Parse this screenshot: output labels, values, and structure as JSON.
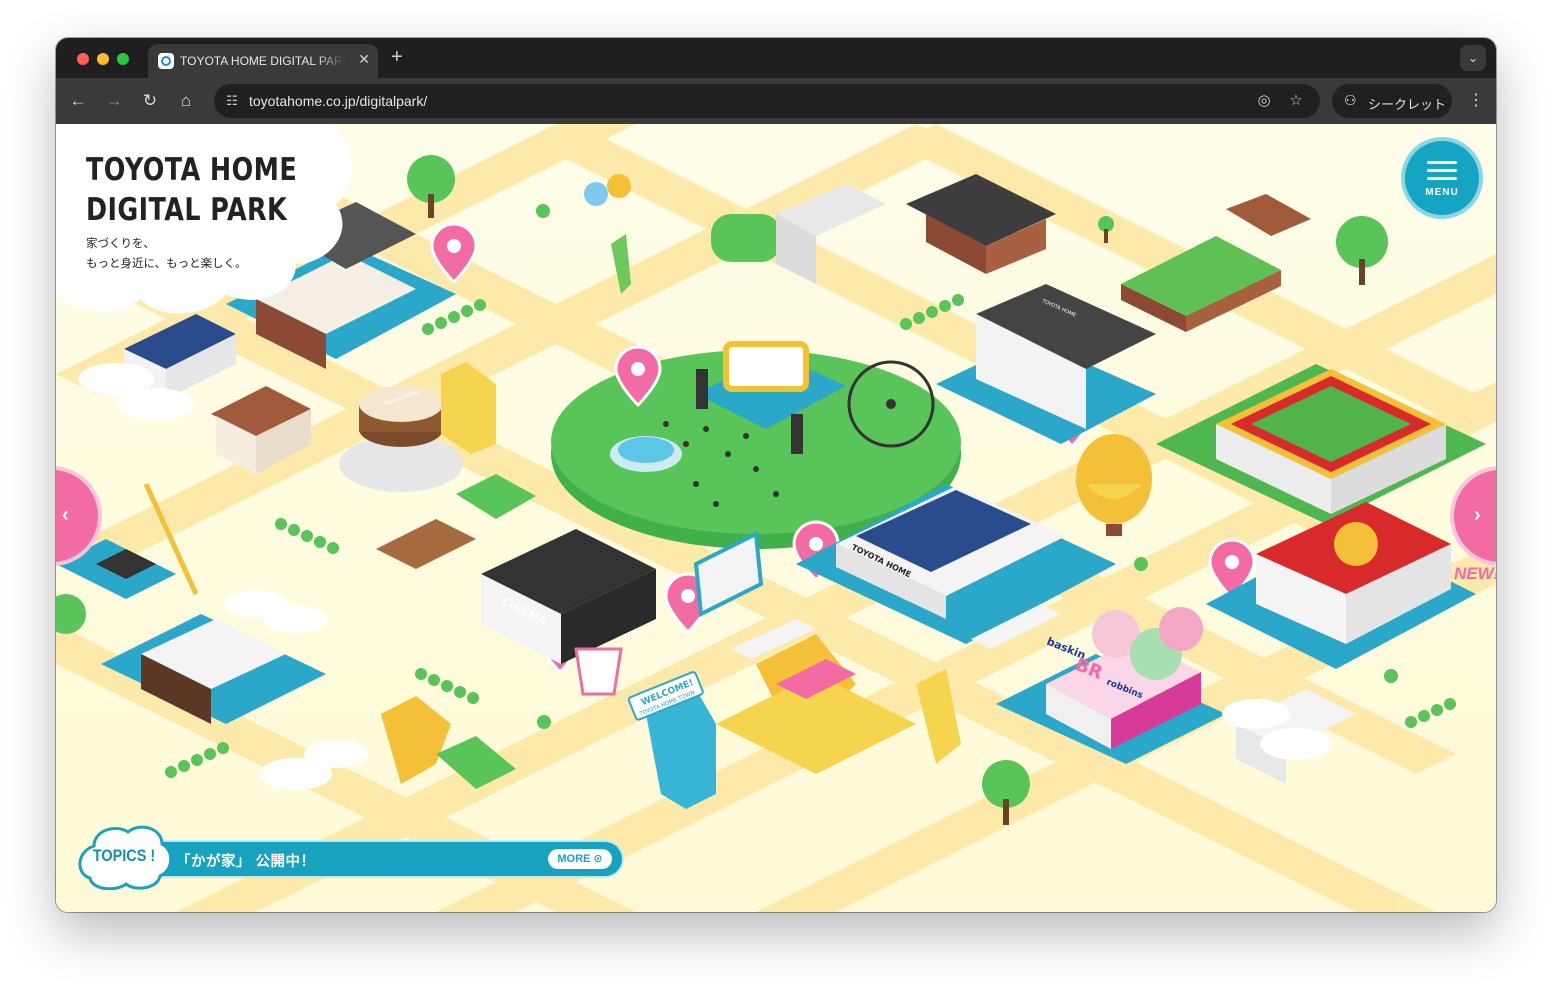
{
  "browser": {
    "tab_title": "TOYOTA HOME DIGITAL PARK",
    "tab_close": "✕",
    "new_tab": "+",
    "url": "toyotahome.co.jp/digitalpark/",
    "incognito_label": "シークレット"
  },
  "site": {
    "logo_line1": "TOYOTA HOME",
    "logo_line2": "DIGITAL PARK",
    "tagline_line1": "家づくりを、",
    "tagline_line2": "もっと身近に、もっと楽しく。",
    "menu_label": "MENU",
    "topics_label": "TOPICS !",
    "topics_text": "「かが家」 公開中！",
    "more_label": "MORE ⊙",
    "new_badge": "NEW!"
  },
  "scene_labels": {
    "cinema": "CINEMA",
    "toyota_home_factory": "TOYOTA HOME",
    "welcome_sign": "WELCOME!",
    "welcome_sub": "TOYOTA HOME TOWN",
    "baskin": "baskin",
    "robbins": "robbins",
    "br": "BR",
    "yokai": "TOYOTA HOME",
    "cake": "Toyota Home"
  },
  "colors": {
    "accent_teal": "#17a2bf",
    "accent_pink": "#f26ca3",
    "ground": "#fffce0",
    "road": "#fde9a8"
  }
}
